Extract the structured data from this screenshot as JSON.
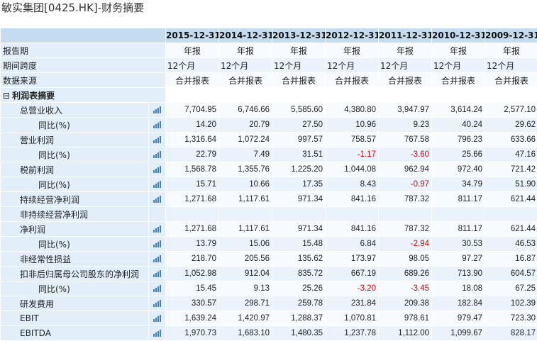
{
  "page_title": "敏实集团[0425.HK]-财务摘要",
  "colors": {
    "header_bg": "#c5dbf0",
    "label_bg": "#e2eefa",
    "negative": "#e00000",
    "chart_icon": "#3d7fd0"
  },
  "icon_name": "bar-chart-icon",
  "years": [
    "2015-12-31",
    "2014-12-31",
    "2013-12-31",
    "2012-12-31",
    "2011-12-31",
    "2010-12-31",
    "2009-12-31"
  ],
  "meta_rows": [
    {
      "label": "报告期",
      "align": "ctr",
      "values": [
        "年报",
        "年报",
        "年报",
        "年报",
        "年报",
        "年报",
        "年报"
      ]
    },
    {
      "label": "期间跨度",
      "align": "lft",
      "values": [
        "12个月",
        "12个月",
        "12个月",
        "12个月",
        "12个月",
        "12个月",
        "12个月"
      ]
    },
    {
      "label": "数据来源",
      "align": "ctr",
      "values": [
        "合并报表",
        "合并报表",
        "合并报表",
        "合并报表",
        "合并报表",
        "合并报表",
        "合并报表"
      ]
    }
  ],
  "section": {
    "toggle": "⊟",
    "label": "利润表摘要"
  },
  "rows": [
    {
      "label": "总营业收入",
      "indent": 1,
      "icon": true,
      "values": [
        "7,704.95",
        "6,746.66",
        "5,585.60",
        "4,380.80",
        "3,947.97",
        "3,614.24",
        "2,577.10"
      ]
    },
    {
      "label": "同比(%)",
      "indent": 2,
      "icon": true,
      "values": [
        "14.20",
        "20.79",
        "27.50",
        "10.96",
        "9.23",
        "40.24",
        "29.62"
      ]
    },
    {
      "label": "营业利润",
      "indent": 1,
      "icon": true,
      "values": [
        "1,316.64",
        "1,072.24",
        "997.57",
        "758.57",
        "767.58",
        "796.23",
        "633.66"
      ]
    },
    {
      "label": "同比(%)",
      "indent": 2,
      "icon": true,
      "values": [
        "22.79",
        "7.49",
        "31.51",
        "-1.17",
        "-3.60",
        "25.66",
        "47.16"
      ]
    },
    {
      "label": "税前利润",
      "indent": 1,
      "icon": true,
      "values": [
        "1,568.78",
        "1,355.76",
        "1,225.20",
        "1,044.08",
        "962.94",
        "972.40",
        "721.42"
      ]
    },
    {
      "label": "同比(%)",
      "indent": 2,
      "icon": true,
      "values": [
        "15.71",
        "10.66",
        "17.35",
        "8.43",
        "-0.97",
        "34.79",
        "51.90"
      ]
    },
    {
      "label": "持续经营净利润",
      "indent": 1,
      "icon": true,
      "values": [
        "1,271.68",
        "1,117.61",
        "971.34",
        "841.16",
        "787.32",
        "811.17",
        "621.44"
      ]
    },
    {
      "label": "非持续经营净利润",
      "indent": 1,
      "icon": false,
      "values": [
        "",
        "",
        "",
        "",
        "",
        "",
        ""
      ]
    },
    {
      "label": "净利润",
      "indent": 1,
      "icon": true,
      "values": [
        "1,271.68",
        "1,117.61",
        "971.34",
        "841.16",
        "787.32",
        "811.17",
        "621.44"
      ]
    },
    {
      "label": "同比(%)",
      "indent": 2,
      "icon": true,
      "values": [
        "13.79",
        "15.06",
        "15.48",
        "6.84",
        "-2.94",
        "30.53",
        "46.53"
      ]
    },
    {
      "label": "非经常性损益",
      "indent": 1,
      "icon": true,
      "values": [
        "218.70",
        "205.56",
        "135.62",
        "173.97",
        "98.05",
        "97.27",
        "16.87"
      ]
    },
    {
      "label": "扣非后归属母公司股东的净利润",
      "indent": 1,
      "icon": true,
      "values": [
        "1,052.98",
        "912.04",
        "835.72",
        "667.19",
        "689.26",
        "713.90",
        "604.57"
      ]
    },
    {
      "label": "同比(%)",
      "indent": 2,
      "icon": true,
      "values": [
        "15.45",
        "9.13",
        "25.26",
        "-3.20",
        "-3.45",
        "18.08",
        "67.25"
      ]
    },
    {
      "label": "研发费用",
      "indent": 1,
      "icon": true,
      "values": [
        "330.57",
        "298.71",
        "259.78",
        "231.84",
        "209.38",
        "182.84",
        "102.39"
      ]
    },
    {
      "label": "EBIT",
      "indent": 1,
      "icon": true,
      "values": [
        "1,639.24",
        "1,420.97",
        "1,288.37",
        "1,070.81",
        "978.61",
        "979.47",
        "723.30"
      ]
    },
    {
      "label": "EBITDA",
      "indent": 1,
      "icon": true,
      "values": [
        "1,970.73",
        "1,683.10",
        "1,480.35",
        "1,237.78",
        "1,112.00",
        "1,099.67",
        "828.17"
      ]
    }
  ]
}
